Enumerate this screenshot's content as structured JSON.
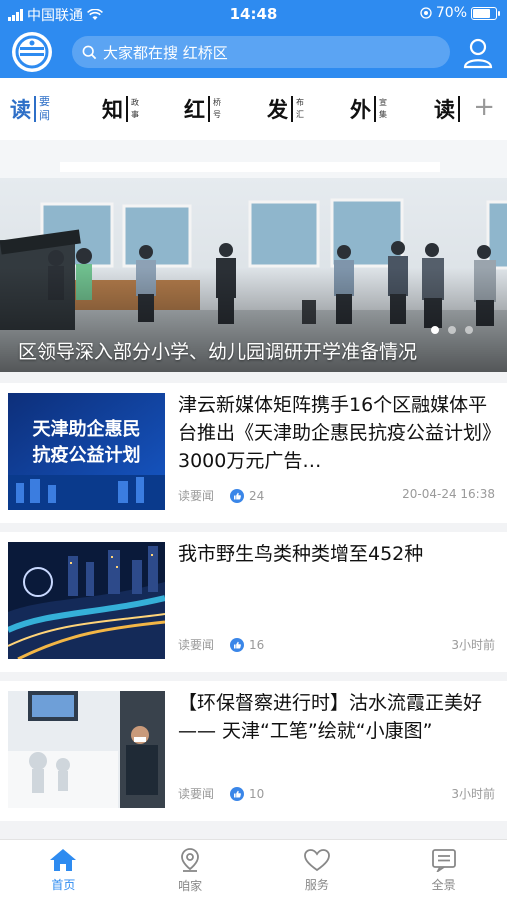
{
  "status_bar": {
    "carrier": "中国联通",
    "time": "14:48",
    "battery": "70%"
  },
  "search": {
    "placeholder": "大家都在搜 红桥区"
  },
  "channels": [
    {
      "big": "读",
      "small": [
        "要",
        "闻"
      ],
      "active": true
    },
    {
      "big": "知",
      "small": [
        "政",
        "事"
      ]
    },
    {
      "big": "红",
      "small": [
        "桥",
        "号"
      ]
    },
    {
      "big": "发",
      "small": [
        "布",
        "汇"
      ]
    },
    {
      "big": "外",
      "small": [
        "宣",
        "集"
      ]
    },
    {
      "big": "读",
      "small": [
        "",
        ""
      ]
    }
  ],
  "channel_add_label": "+",
  "banner": {
    "title": "区领导深入部分小学、幼儿园调研开学准备情况",
    "active_dot": 1,
    "dot_count": 3
  },
  "articles": [
    {
      "title": "津云新媒体矩阵携手16个区融媒体平台推出《天津助企惠民抗疫公益计划》3000万元广告…",
      "thumb_text": [
        "天津助企惠民",
        "抗疫公益计划"
      ],
      "source": "读要闻",
      "likes": "24",
      "time": "20-04-24 16:38"
    },
    {
      "title": "我市野生鸟类种类增至452种",
      "source": "读要闻",
      "likes": "16",
      "time": "3小时前"
    },
    {
      "title": "【环保督察进行时】沽水流霞正美好 —— 天津“工笔”绘就“小康图”",
      "source": "读要闻",
      "likes": "10",
      "time": "3小时前"
    }
  ],
  "tabs": [
    {
      "label": "首页",
      "icon": "home-icon",
      "active": true
    },
    {
      "label": "咱家",
      "icon": "location-icon"
    },
    {
      "label": "服务",
      "icon": "heart-icon"
    },
    {
      "label": "全景",
      "icon": "news-icon"
    }
  ],
  "colors": {
    "brand": "#2e8bf0",
    "channel_active": "#2e6fc7",
    "meta_gray": "#9a9a9a"
  }
}
